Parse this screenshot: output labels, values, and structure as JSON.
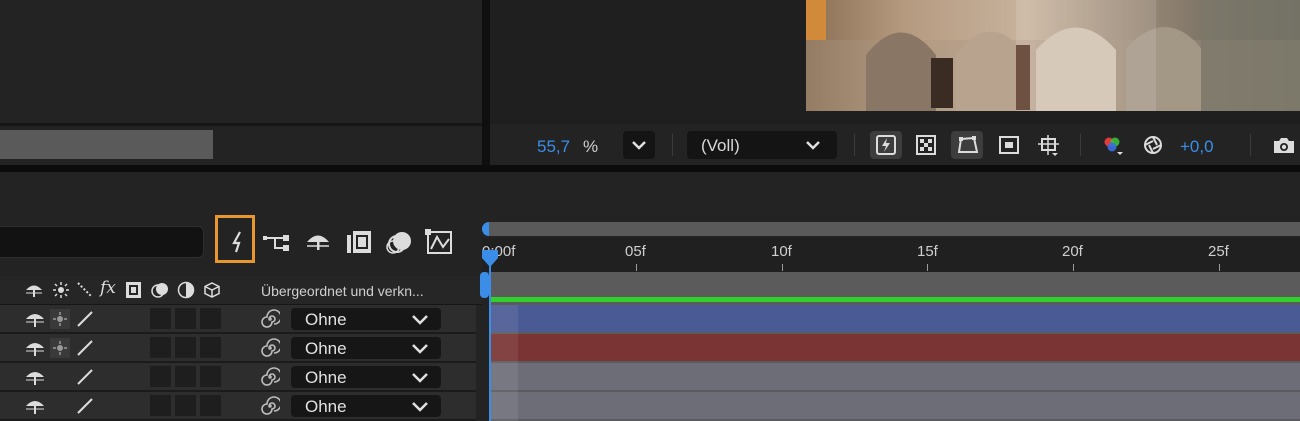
{
  "viewer": {
    "zoom_value": "55,7",
    "zoom_unit": "%",
    "resolution": "(Voll)",
    "exposure_value": "+0,0"
  },
  "timeline": {
    "column_header_parent": "Übergeordnet und verkn...",
    "ruler_labels": [
      "0:00f",
      "05f",
      "10f",
      "15f",
      "20f",
      "25f"
    ],
    "layers": [
      {
        "parent": "Ohne",
        "color": "#4a5a94"
      },
      {
        "parent": "Ohne",
        "color": "#7a3434"
      },
      {
        "parent": "Ohne",
        "color": "#6d6d78"
      },
      {
        "parent": "Ohne",
        "color": "#6d6d78"
      }
    ]
  },
  "colors": {
    "accent": "#3b8ee8",
    "highlight": "#e8972f",
    "work_area": "#2fd12f"
  }
}
